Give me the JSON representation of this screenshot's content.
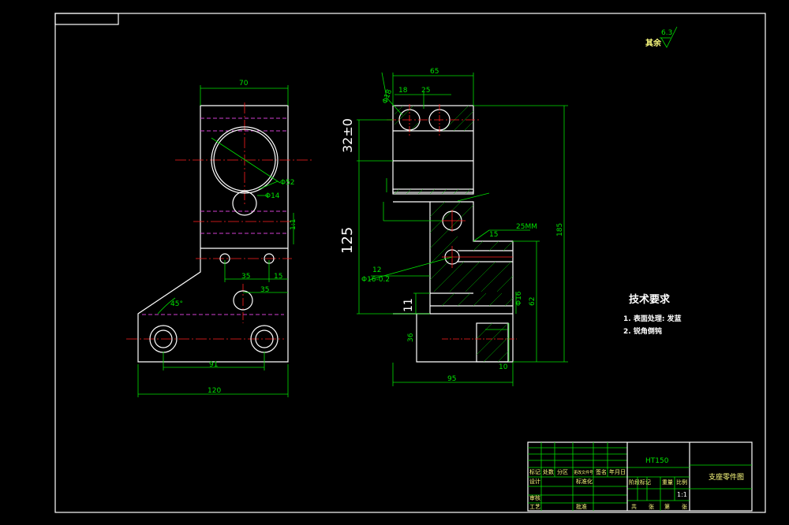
{
  "dims_left": {
    "width_top": "70",
    "dia_big": "Φ52",
    "dia_small": "Φ14",
    "d35a": "35",
    "d15": "15",
    "d35b": "35",
    "angle": "45°",
    "d91": "91",
    "width_bottom": "120",
    "side_label": "1:1"
  },
  "dims_right": {
    "top_width": "65",
    "d18": "18",
    "d25": "25",
    "h32": "32±0",
    "h125": "125",
    "d11": "11",
    "d185": "185",
    "d62": "62",
    "d95": "95",
    "d16": "Φ16",
    "d10": "10",
    "d15": "15",
    "d36": "36",
    "dia_hole": "Φ16-0.2",
    "d12": "12",
    "tol": "Φ18",
    "label_25mm": "25MM"
  },
  "roughness": {
    "value": "6.3",
    "label": "其余"
  },
  "tech_req": {
    "title": "技术要求",
    "item1": "1. 表面处理: 发蓝",
    "item2": "2. 锐角倒钝"
  },
  "title_block": {
    "material": "HT150",
    "part_name": "支座零件图",
    "scale": "1:1",
    "labels": [
      "标记",
      "处数",
      "分区",
      "更改文件号",
      "签名",
      "年月日",
      "设计",
      "标准化",
      "阶段标记",
      "重量",
      "比例",
      "审核",
      "工艺",
      "批准",
      "共",
      "张",
      "第",
      "张"
    ]
  }
}
